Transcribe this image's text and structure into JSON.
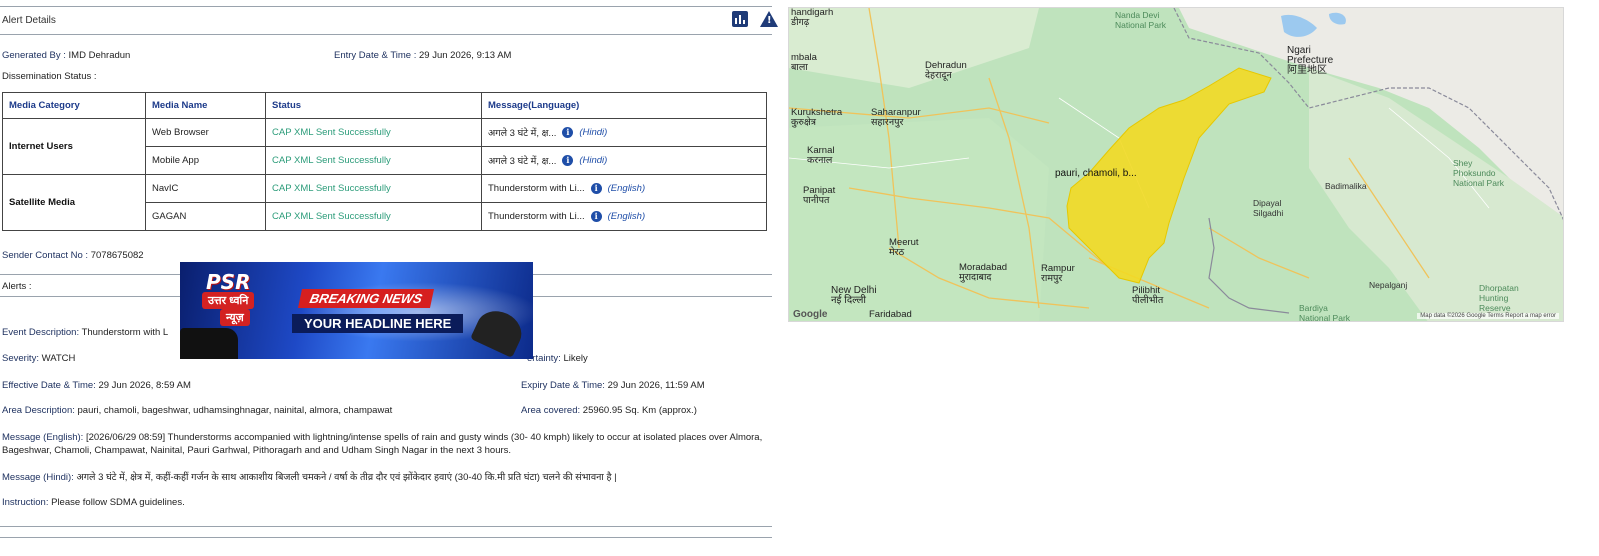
{
  "panel": {
    "title": "Alert Details",
    "generated_by_label": "Generated By :",
    "generated_by": "IMD Dehradun",
    "entry_label": "Entry Date & Time :",
    "entry_value": "29 Jun 2026, 9:13 AM",
    "dissemination_label": "Dissemination Status :"
  },
  "table": {
    "headers": [
      "Media Category",
      "Media Name",
      "Status",
      "Message(Language)"
    ],
    "categories": [
      "Internet Users",
      "Satellite Media"
    ],
    "rows": [
      {
        "name": "Web Browser",
        "status": "CAP XML Sent Successfully",
        "message": "अगले 3 घंटे में, क्ष...",
        "lang": "(Hindi)"
      },
      {
        "name": "Mobile App",
        "status": "CAP XML Sent Successfully",
        "message": "अगले 3 घंटे में, क्ष...",
        "lang": "(Hindi)"
      },
      {
        "name": "NavIC",
        "status": "CAP XML Sent Successfully",
        "message": "Thunderstorm with Li...",
        "lang": "(English)"
      },
      {
        "name": "GAGAN",
        "status": "CAP XML Sent Successfully",
        "message": "Thunderstorm with Li...",
        "lang": "(English)"
      }
    ]
  },
  "sender": {
    "label": "Sender Contact No :",
    "value": "7078675082"
  },
  "alerts_label": "Alerts :",
  "banner": {
    "brand": "PSR",
    "brand_line1": "उत्तर ध्वनि",
    "brand_line2": "न्यूज़",
    "breaking": "BREAKING NEWS",
    "headline": "YOUR HEADLINE HERE"
  },
  "alert": {
    "event_label": "Event Description:",
    "event_value": "Thunderstorm with L",
    "severity_label": "Severity:",
    "severity_value": "WATCH",
    "certainty_label": "ertainty:",
    "certainty_value": "Likely",
    "effective_label": "Effective Date & Time:",
    "effective_value": "29 Jun 2026, 8:59 AM",
    "expiry_label": "Expiry Date & Time:",
    "expiry_value": "29 Jun 2026, 11:59 AM",
    "area_desc_label": "Area Description:",
    "area_desc_value": "pauri, chamoli, bageshwar, udhamsinghnagar, nainital, almora, champawat",
    "area_cov_label": "Area covered:",
    "area_cov_value": "25960.95 Sq. Km (approx.)",
    "msg_en_label": "Message (English):",
    "msg_en_value": "[2026/06/29 08:59] Thunderstorms accompanied with lightning/intense spells of rain and gusty winds (30- 40 kmph) likely to occur at isolated places over Almora, Bageshwar, Chamoli, Champawat, Nainital, Pauri Garhwal, Pithoragarh and and Udham Singh Nagar in the next 3 hours.",
    "msg_hi_label": "Message (Hindi):",
    "msg_hi_value": "अगले 3 घंटे में, क्षेत्र में, कहीं-कहीं गर्जन के साथ आकाशीय बिजली चमकने / वर्षा के तीव्र दौर एवं झोंकेदार हवाएं (30-40 कि.मी प्रति घंटा) चलने की संभावना है |",
    "instruction_label": "Instruction:",
    "instruction_value": "Please follow SDMA guidelines."
  },
  "map": {
    "area_label": "pauri, chamoli, b...",
    "places": [
      {
        "id": "chandigarh",
        "text": "handigarh\nडीगढ़"
      },
      {
        "id": "ambala",
        "text": "mbala\nबाला"
      },
      {
        "id": "kurukshetra",
        "text": "Kurukshetra\nकुरुक्षेत्र"
      },
      {
        "id": "karnal",
        "text": "Karnal\nकरनाल"
      },
      {
        "id": "panipat",
        "text": "Panipat\nपानीपत"
      },
      {
        "id": "saharanpur",
        "text": "Saharanpur\nसहारनपुर"
      },
      {
        "id": "dehradun",
        "text": "Dehradun\nदेहरादून"
      },
      {
        "id": "meerut",
        "text": "Meerut\nमेरठ"
      },
      {
        "id": "newdelhi",
        "text": "New Delhi\nनई दिल्ली"
      },
      {
        "id": "faridabad",
        "text": "Faridabad"
      },
      {
        "id": "moradabad",
        "text": "Moradabad\nमुरादाबाद"
      },
      {
        "id": "rampur",
        "text": "Rampur\nरामपुर"
      },
      {
        "id": "pilibhit",
        "text": "Pilibhit\nपीलीभीत"
      },
      {
        "id": "ngari",
        "text": "Ngari\nPrefecture\n阿里地区"
      },
      {
        "id": "nandadevi",
        "text": "Nanda Devi\nNational Park"
      },
      {
        "id": "badimalika",
        "text": "Badimalika"
      },
      {
        "id": "dipayal",
        "text": "Dipayal\nSilgadhi"
      },
      {
        "id": "shey",
        "text": "Shey\nPhoksundo\nNational Park"
      },
      {
        "id": "newdelhi2",
        "text": "Dhorpatan\nHunting\nReserve"
      },
      {
        "id": "bardiya",
        "text": "Bardiya\nNational Park"
      },
      {
        "id": "nepalganj",
        "text": "Nepalganj"
      }
    ],
    "google": "Google",
    "footer": "Map data ©2026 Google   Terms   Report a map error"
  }
}
